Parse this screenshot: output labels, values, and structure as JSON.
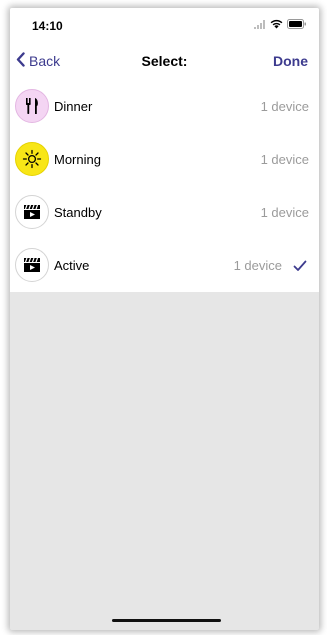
{
  "status_bar": {
    "time": "14:10"
  },
  "nav": {
    "back_label": "Back",
    "title": "Select:",
    "done_label": "Done"
  },
  "items": [
    {
      "name": "Dinner",
      "count": "1 device",
      "icon": "fork-knife-icon",
      "selected": false
    },
    {
      "name": "Morning",
      "count": "1 device",
      "icon": "sun-icon",
      "selected": false
    },
    {
      "name": "Standby",
      "count": "1 device",
      "icon": "clapperboard-icon",
      "selected": false
    },
    {
      "name": "Active",
      "count": "1 device",
      "icon": "clapperboard-icon",
      "selected": true
    }
  ],
  "colors": {
    "accent": "#3d3b8e",
    "dinner_bg": "#f4d5f3",
    "morning_bg": "#f8e617",
    "secondary_text": "#9b9b9b",
    "background": "#e6e6e6"
  }
}
